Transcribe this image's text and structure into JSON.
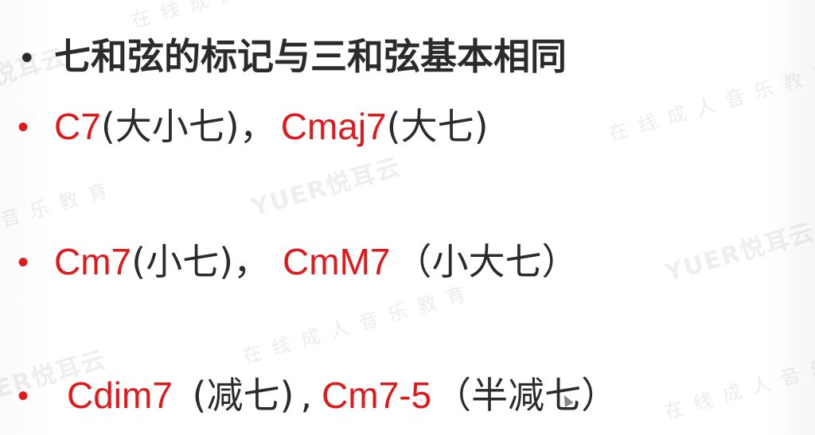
{
  "heading": {
    "bullet": "•",
    "text": "七和弦的标记与三和弦基本相同"
  },
  "rows": [
    {
      "bullet": "•",
      "a_code": "C7",
      "a_desc": "(大小七)",
      "sep": "，",
      "b_code": "Cmaj7",
      "b_desc": "(大七)"
    },
    {
      "bullet": "•",
      "a_code": "Cm7",
      "a_desc": "(小七)",
      "sep": "，",
      "b_code": "CmM7",
      "b_desc": "（小大七）"
    },
    {
      "bullet": "•",
      "a_code": "Cdim7",
      "a_desc": " (减七)",
      "sep": ",",
      "b_code": "Cm7-5",
      "b_desc": "（半减七）"
    }
  ],
  "watermark": {
    "text": "在线成人音乐教育",
    "brand": "YUER悦耳云"
  },
  "colors": {
    "red": "#e0191c",
    "dark": "#2b2b2b",
    "watermark": "#aaaaaa"
  }
}
